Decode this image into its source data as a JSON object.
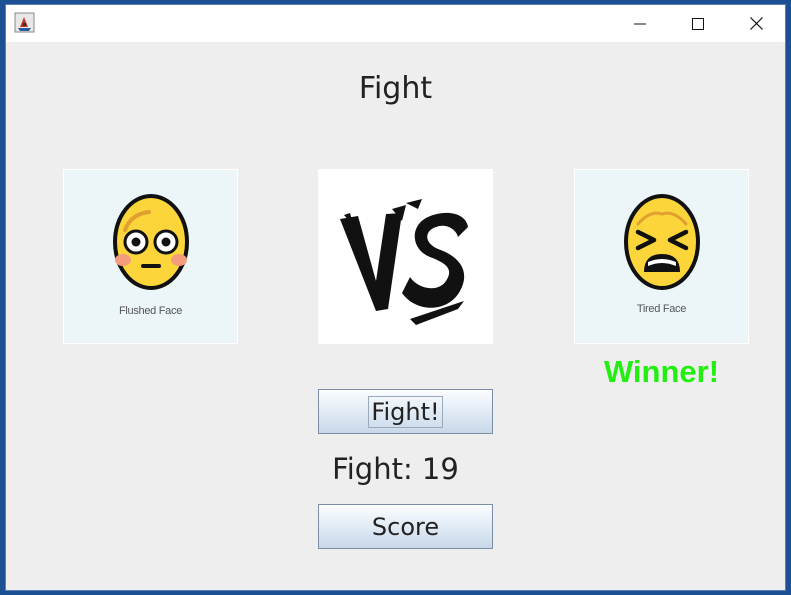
{
  "window": {
    "title": ""
  },
  "heading": "Fight",
  "left_card": {
    "icon": "flushed-face-icon",
    "caption": "Flushed Face"
  },
  "right_card": {
    "icon": "tired-face-icon",
    "caption": "Tired Face"
  },
  "vs_image": {
    "icon": "vs-icon"
  },
  "winner_label": "Winner!",
  "fight_button": {
    "label": "Fight!"
  },
  "fight_counter": "Fight: 19",
  "score_button": {
    "label": "Score"
  },
  "colors": {
    "winner": "#22ee11",
    "window_bg": "#eeeeee",
    "card_bg": "#ecf6f9",
    "face_yellow": "#fbd53a"
  }
}
